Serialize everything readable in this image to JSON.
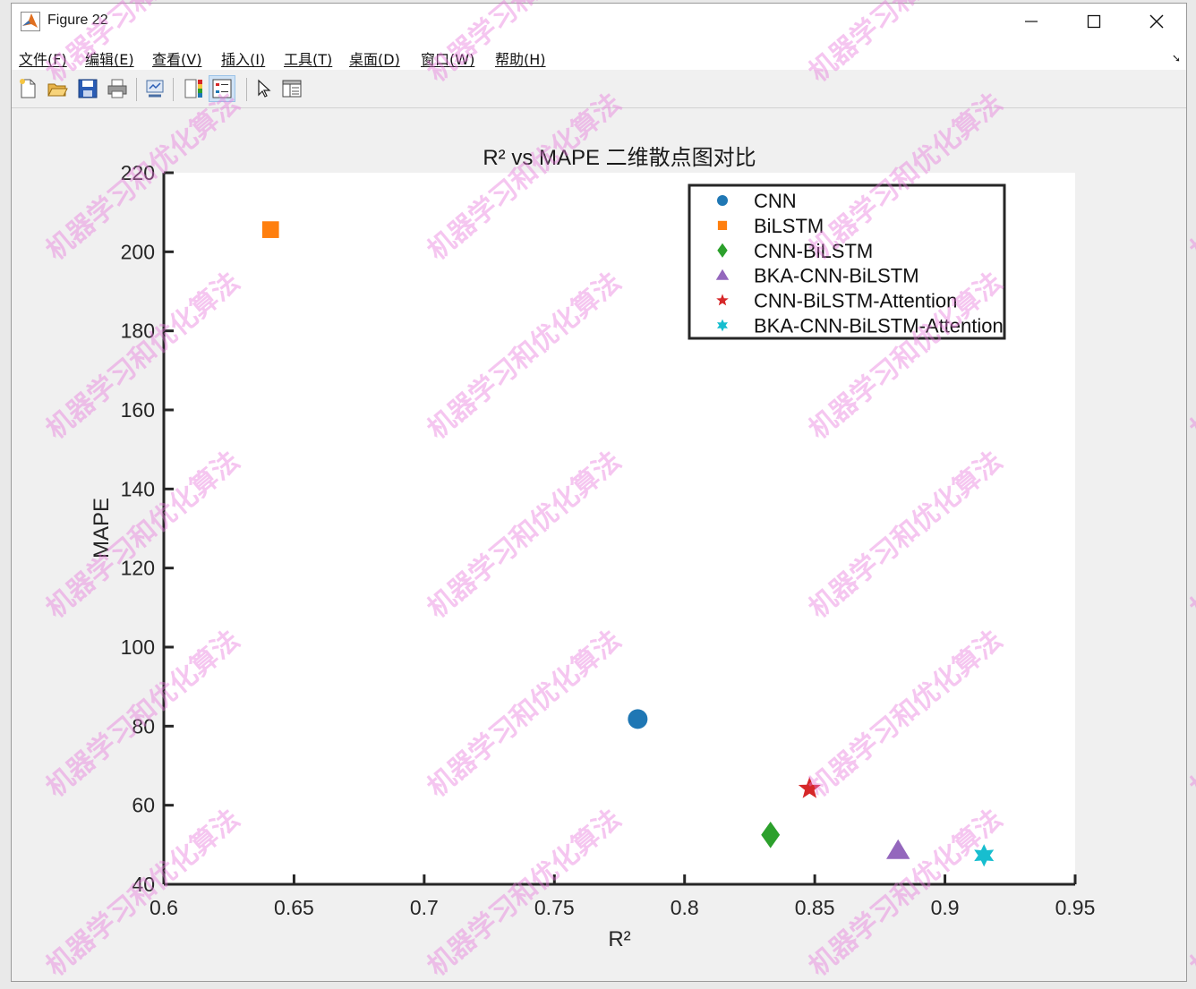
{
  "window": {
    "title": "Figure 22",
    "controls": {
      "minimize": "—",
      "maximize": "☐",
      "close": "✕"
    }
  },
  "menu": {
    "items": [
      "文件(F)",
      "编辑(E)",
      "查看(V)",
      "插入(I)",
      "工具(T)",
      "桌面(D)",
      "窗口(W)",
      "帮助(H)"
    ]
  },
  "toolbar": {
    "buttons": [
      "new-figure-icon",
      "open-file-icon",
      "save-icon",
      "print-icon",
      "link-plot-icon",
      "insert-colorbar-icon",
      "insert-legend-icon",
      "edit-plot-pointer-icon",
      "property-inspector-icon"
    ]
  },
  "watermark": {
    "text": "机器学习和优化算法"
  },
  "chart_data": {
    "type": "scatter",
    "title": "R² vs MAPE 二维散点图对比",
    "xlabel": "R²",
    "ylabel": "MAPE",
    "xlim": [
      0.6,
      0.95
    ],
    "ylim": [
      40,
      220
    ],
    "xticks": [
      "0.6",
      "0.65",
      "0.7",
      "0.75",
      "0.8",
      "0.85",
      "0.9",
      "0.95"
    ],
    "yticks": [
      "40",
      "60",
      "80",
      "100",
      "120",
      "140",
      "160",
      "180",
      "200",
      "220"
    ],
    "grid": false,
    "legend_position": "top-right",
    "series": [
      {
        "name": "CNN",
        "marker": "circle",
        "color": "#1f77b4",
        "x": 0.782,
        "y": 81.8
      },
      {
        "name": "BiLSTM",
        "marker": "square",
        "color": "#ff7f0e",
        "x": 0.641,
        "y": 205.6
      },
      {
        "name": "CNN-BiLSTM",
        "marker": "diamond",
        "color": "#2ca02c",
        "x": 0.833,
        "y": 52.5
      },
      {
        "name": "BKA-CNN-BiLSTM",
        "marker": "triangle",
        "color": "#9467bd",
        "x": 0.882,
        "y": 48.5
      },
      {
        "name": "CNN-BiLSTM-Attention",
        "marker": "star5",
        "color": "#d62728",
        "x": 0.848,
        "y": 64.2
      },
      {
        "name": "BKA-CNN-BiLSTM-Attention",
        "marker": "star6",
        "color": "#17becf",
        "x": 0.915,
        "y": 47.3
      }
    ]
  }
}
